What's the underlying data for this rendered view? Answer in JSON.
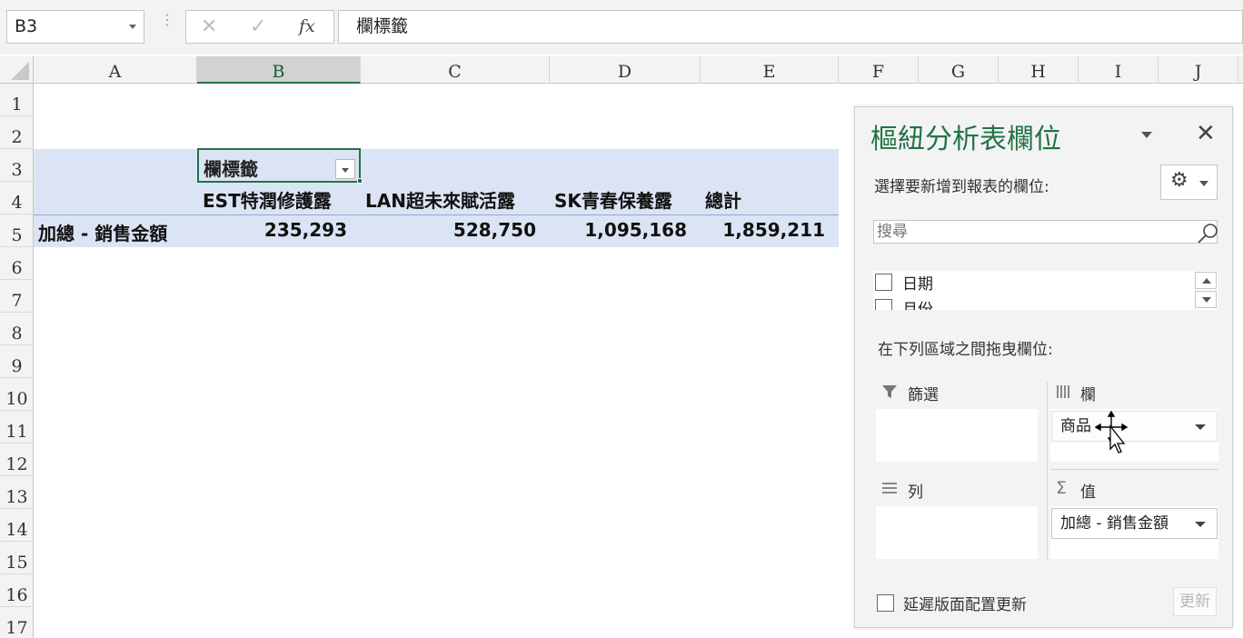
{
  "formula_bar": {
    "name_box": "B3",
    "cancel_symbol": "✕",
    "enter_symbol": "✓",
    "fx_symbol": "fx",
    "formula_value": "欄標籤"
  },
  "columns": [
    "A",
    "B",
    "C",
    "D",
    "E",
    "F",
    "G",
    "H",
    "I",
    "J"
  ],
  "selected_column": "B",
  "rows": [
    "1",
    "2",
    "3",
    "4",
    "5",
    "6",
    "7",
    "8",
    "9",
    "10",
    "11",
    "12",
    "13",
    "14",
    "15",
    "16",
    "17"
  ],
  "pivot": {
    "column_labels_header": "欄標籤",
    "headers": [
      "EST特潤修護露",
      "LAN超未來賦活露",
      "SK青春保養露",
      "總計"
    ],
    "row_label": "加總 - 銷售金額",
    "values": [
      "235,293",
      "528,750",
      "1,095,168",
      "1,859,211"
    ]
  },
  "field_pane": {
    "title": "樞紐分析表欄位",
    "choose_fields_label": "選擇要新增到報表的欄位:",
    "search_placeholder": "搜尋",
    "fields": [
      {
        "label": "日期",
        "checked": false
      },
      {
        "label": "月份",
        "checked": false
      }
    ],
    "drag_label": "在下列區域之間拖曳欄位:",
    "areas": {
      "filters": {
        "title": "篩選",
        "items": []
      },
      "columns": {
        "title": "欄",
        "items": [
          "商品"
        ]
      },
      "rows": {
        "title": "列",
        "items": []
      },
      "values": {
        "title": "值",
        "items": [
          "加總 - 銷售金額"
        ]
      }
    },
    "defer_label": "延遲版面配置更新",
    "update_label": "更新"
  },
  "colors": {
    "accent_green": "#217346",
    "pivot_band": "#dbe4f4"
  },
  "icons": [
    "gear-icon",
    "search-icon",
    "close-icon",
    "filter-icon",
    "columns-icon",
    "rows-icon",
    "sigma-icon",
    "move-cursor-icon"
  ]
}
